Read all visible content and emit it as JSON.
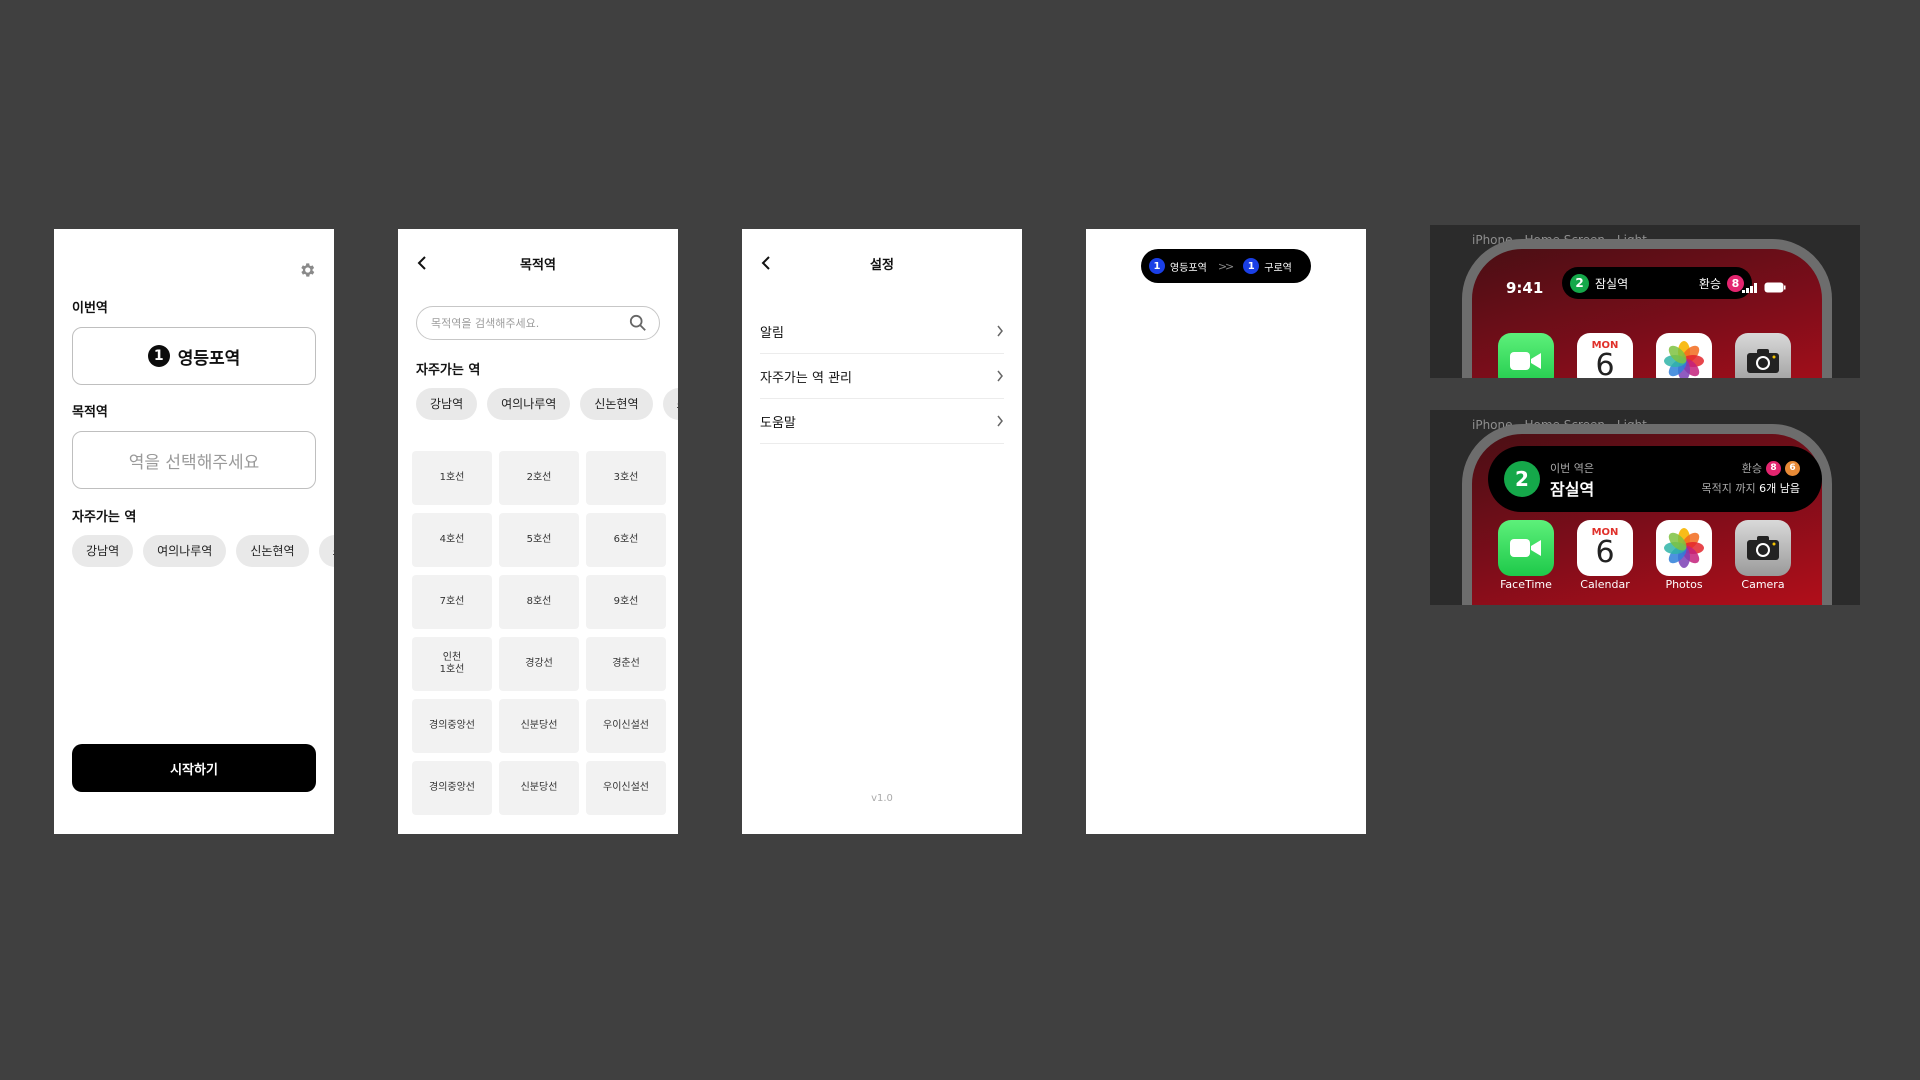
{
  "screen1": {
    "current_label": "이번역",
    "current_station": "영등포역",
    "current_line": "1",
    "dest_label": "목적역",
    "dest_placeholder": "역을 선택해주세요",
    "freq_label": "자주가는 역",
    "chips": [
      "강남역",
      "여의나루역",
      "신논현역",
      "스"
    ],
    "start_button": "시작하기"
  },
  "screen2": {
    "title": "목적역",
    "search_placeholder": "목적역을 검색해주세요.",
    "freq_label": "자주가는 역",
    "chips": [
      "강남역",
      "여의나루역",
      "신논현역",
      "스"
    ],
    "lines": [
      "1호선",
      "2호선",
      "3호선",
      "4호선",
      "5호선",
      "6호선",
      "7호선",
      "8호선",
      "9호선",
      "인천\n1호선",
      "경강선",
      "경춘선",
      "경의중앙선",
      "신분당선",
      "우이신설선",
      "경의중앙선",
      "신분당선",
      "우이신설선"
    ]
  },
  "screen3": {
    "title": "설정",
    "menu": [
      "알림",
      "자주가는 역 관리",
      "도움말"
    ],
    "version": "v1.0"
  },
  "screen4": {
    "from_line": "1",
    "from_station": "영등포역",
    "arrows": ">>",
    "to_line": "1",
    "to_station": "구로역"
  },
  "preview1": {
    "label": "iPhone - Home Screen - Light",
    "time": "9:41",
    "line": "2",
    "station": "잠실역",
    "transfer_label": "환승",
    "transfer_line": "8"
  },
  "preview2": {
    "label": "iPhone - Home Screen - Light",
    "line": "2",
    "this_station_label": "이번 역은",
    "station": "잠실역",
    "transfer_label": "환승",
    "transfer_lines": [
      "8",
      "6"
    ],
    "remaining_prefix": "목적지 까지",
    "remaining": "6개 남음"
  },
  "apps": [
    {
      "name": "FaceTime",
      "icon": "facetime-icon"
    },
    {
      "name": "Calendar",
      "icon": "calendar-icon",
      "dow": "MON",
      "day": "6"
    },
    {
      "name": "Photos",
      "icon": "photos-icon"
    },
    {
      "name": "Camera",
      "icon": "camera-icon"
    }
  ],
  "colors": {
    "line1": "#1a3fe6",
    "line2": "#15a84a",
    "line8": "#e3256f",
    "line6": "#e88a36",
    "background": "#404040"
  }
}
